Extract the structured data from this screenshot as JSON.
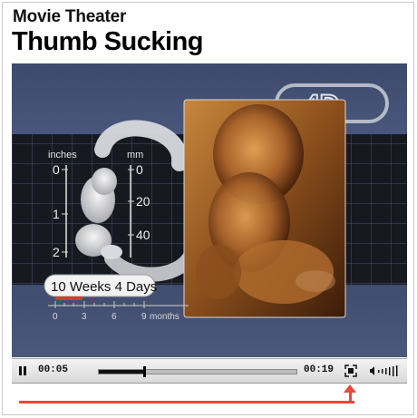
{
  "header": {
    "kicker": "Movie Theater",
    "title": "Thumb Sucking"
  },
  "video": {
    "logo_text": "4D",
    "ruler_inches_label": "inches",
    "ruler_mm_label": "mm",
    "inch_ticks": [
      "0",
      "1",
      "2"
    ],
    "mm_ticks": [
      "0",
      "20",
      "40"
    ],
    "age_label": "10 Weeks 4 Days",
    "month_ticks": [
      "0",
      "3",
      "6",
      "9"
    ],
    "month_unit": "months"
  },
  "controls": {
    "elapsed": "00:05",
    "duration": "00:19",
    "progress_fraction": 0.23,
    "pause_icon": "pause-icon",
    "fullscreen_icon": "fullscreen-icon",
    "volume_icon": "volume-icon"
  },
  "colors": {
    "annotation": "#ef4637",
    "screen_bg": "#3d4a6b"
  }
}
